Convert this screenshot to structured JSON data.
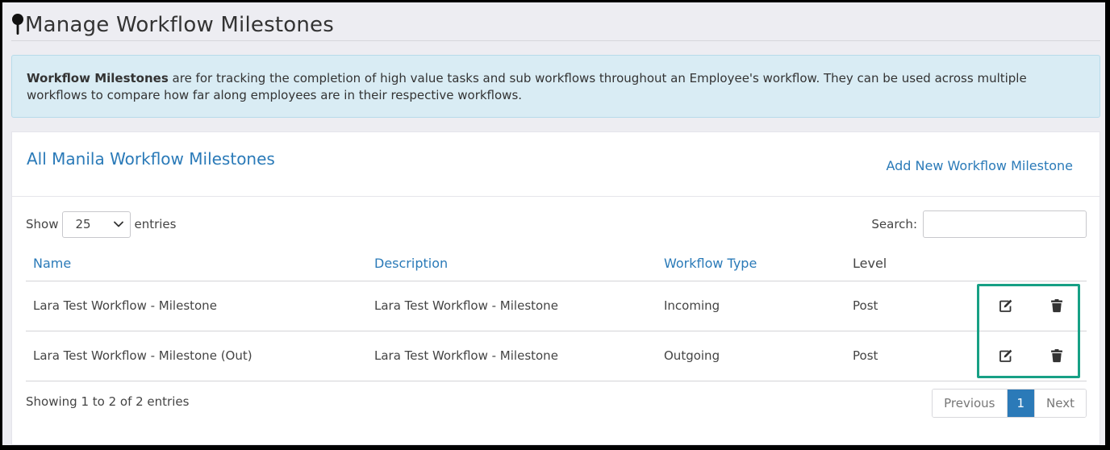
{
  "page": {
    "title": "Manage Workflow Milestones"
  },
  "alert": {
    "bold": "Workflow Milestones",
    "text": " are for tracking the completion of high value tasks and sub workflows throughout an Employee's workflow. They can be used across multiple workflows to compare how far along employees are in their respective workflows."
  },
  "card": {
    "title": "All Manila Workflow Milestones",
    "add_label": "Add New Workflow Milestone"
  },
  "controls": {
    "show_label": "Show",
    "entries_label": "entries",
    "page_length": "25",
    "search_label": "Search:",
    "search_value": ""
  },
  "table": {
    "headers": [
      "Name",
      "Description",
      "Workflow Type",
      "Level"
    ],
    "rows": [
      {
        "name": "Lara Test Workflow - Milestone",
        "description": "Lara Test Workflow - Milestone",
        "type": "Incoming",
        "level": "Post"
      },
      {
        "name": "Lara Test Workflow - Milestone (Out)",
        "description": "Lara Test Workflow - Milestone",
        "type": "Outgoing",
        "level": "Post"
      }
    ]
  },
  "footer": {
    "info": "Showing 1 to 2 of 2 entries",
    "prev_label": "Previous",
    "current_page": "1",
    "next_label": "Next"
  },
  "colors": {
    "link": "#2a7ab8",
    "highlight": "#17a085",
    "alert_bg": "#d9ecf4"
  },
  "icons": {
    "title": "map-pin-icon",
    "edit": "edit-icon",
    "delete": "trash-icon",
    "select": "chevron-down-icon"
  }
}
